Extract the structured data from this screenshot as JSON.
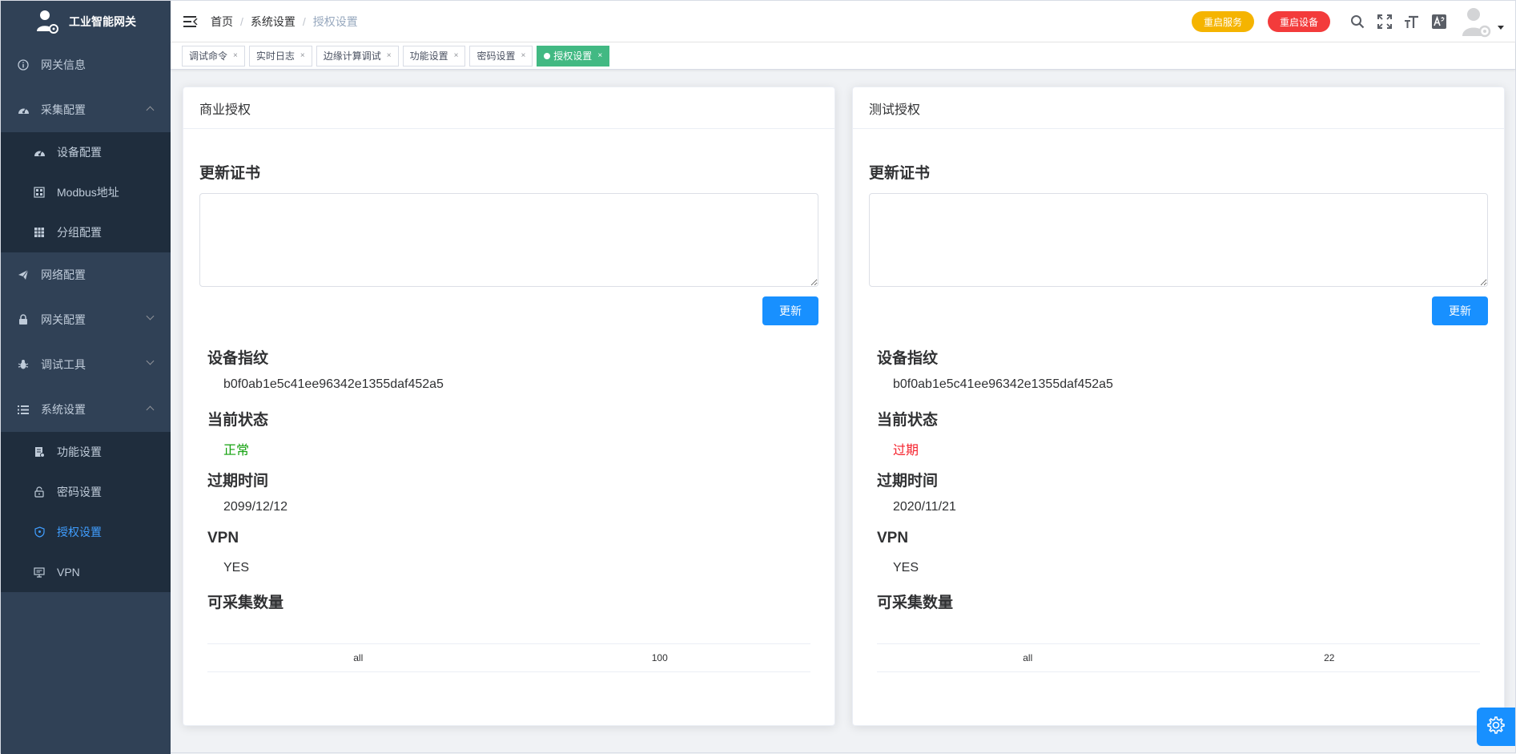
{
  "app": {
    "title": "工业智能网关"
  },
  "sidebar": {
    "items": [
      {
        "label": "网关信息",
        "icon": "info-icon"
      },
      {
        "label": "采集配置",
        "icon": "dashboard-icon",
        "expanded": true
      },
      {
        "label": "设备配置",
        "icon": "dashboard-icon"
      },
      {
        "label": "Modbus地址",
        "icon": "grid-icon"
      },
      {
        "label": "分组配置",
        "icon": "table-icon"
      },
      {
        "label": "网络配置",
        "icon": "send-icon"
      },
      {
        "label": "网关配置",
        "icon": "lock-icon",
        "expanded": false
      },
      {
        "label": "调试工具",
        "icon": "bug-icon",
        "expanded": false
      },
      {
        "label": "系统设置",
        "icon": "list-icon",
        "expanded": true
      },
      {
        "label": "功能设置",
        "icon": "document-icon"
      },
      {
        "label": "密码设置",
        "icon": "unlock-icon"
      },
      {
        "label": "授权设置",
        "icon": "shield-icon",
        "active": true
      },
      {
        "label": "VPN",
        "icon": "monitor-icon"
      }
    ]
  },
  "header": {
    "breadcrumb": [
      "首页",
      "系统设置",
      "授权设置"
    ],
    "restart_service": "重启服务",
    "restart_device": "重启设备"
  },
  "tags": [
    "调试命令",
    "实时日志",
    "边缘计算调试",
    "功能设置",
    "密码设置",
    "授权设置"
  ],
  "commercial": {
    "title": "商业授权",
    "update_cert": "更新证书",
    "update_btn": "更新",
    "fingerprint_label": "设备指纹",
    "fingerprint": "b0f0ab1e5c41ee96342e1355daf452a5",
    "status_label": "当前状态",
    "status": "正常",
    "expire_label": "过期时间",
    "expire": "2099/12/12",
    "vpn_label": "VPN",
    "vpn": "YES",
    "count_label": "可采集数量",
    "table": [
      "all",
      "100"
    ]
  },
  "test": {
    "title": "测试授权",
    "update_cert": "更新证书",
    "update_btn": "更新",
    "fingerprint_label": "设备指纹",
    "fingerprint": "b0f0ab1e5c41ee96342e1355daf452a5",
    "status_label": "当前状态",
    "status": "过期",
    "expire_label": "过期时间",
    "expire": "2020/11/21",
    "vpn_label": "VPN",
    "vpn": "YES",
    "count_label": "可采集数量",
    "table": [
      "all",
      "22"
    ]
  },
  "colors": {
    "sidebar": "#304156",
    "submenu": "#1f2d3d",
    "active": "#409eff",
    "primary": "#1890ff",
    "tag_active": "#42b983",
    "ok": "#13a10e",
    "bad": "#f5222d"
  }
}
